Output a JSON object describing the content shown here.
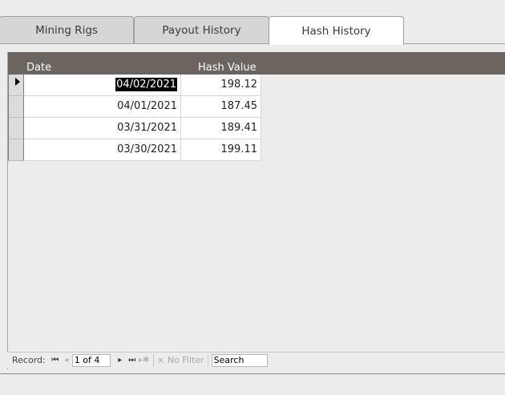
{
  "tabs": [
    {
      "label": "Mining Rigs",
      "active": false
    },
    {
      "label": "Payout History",
      "active": false
    },
    {
      "label": "Hash History",
      "active": true
    }
  ],
  "table": {
    "columns": [
      "Date",
      "Hash Value"
    ],
    "rows": [
      {
        "date": "04/02/2021",
        "hash": "198.12",
        "current": true
      },
      {
        "date": "04/01/2021",
        "hash": "187.45",
        "current": false
      },
      {
        "date": "03/31/2021",
        "hash": "189.41",
        "current": false
      },
      {
        "date": "03/30/2021",
        "hash": "199.11",
        "current": false
      }
    ]
  },
  "nav": {
    "record_label": "Record:",
    "record_value": "1 of 4",
    "filter_label": "No Filter",
    "search_value": "Search"
  },
  "icons": {
    "first": "first-record-icon",
    "prev": "previous-record-icon",
    "next": "next-record-icon",
    "last": "last-record-icon",
    "new": "new-record-icon",
    "filter": "filter-icon",
    "selector": "current-record-arrow-icon"
  }
}
